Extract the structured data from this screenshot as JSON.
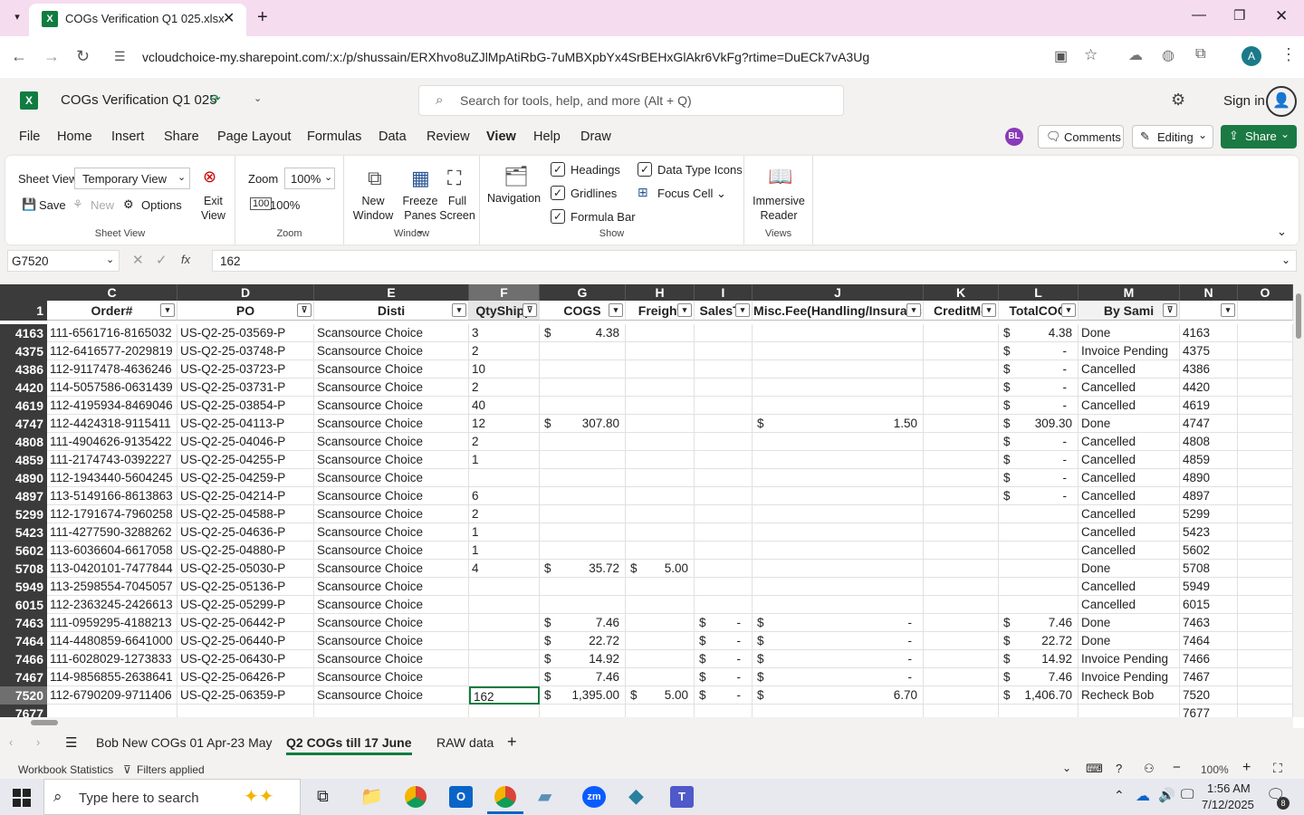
{
  "browser": {
    "tab_title": "COGs Verification Q1 025.xlsx",
    "url": "vcloudchoice-my.sharepoint.com/:x:/p/shussain/ERXhvo8uZJlMpAtiRbG-7uMBXpbYx4SrBEHxGlAkr6VkFg?rtime=DuECk7vA3Ug",
    "profile_initial": "A"
  },
  "app": {
    "file_title": "COGs Verification Q1 025",
    "search_placeholder": "Search for tools, help, and more (Alt + Q)",
    "sign_in": "Sign in",
    "user_initials": "BL",
    "comments": "Comments",
    "editing": "Editing",
    "share": "Share"
  },
  "menu": [
    "File",
    "Home",
    "Insert",
    "Share",
    "Page Layout",
    "Formulas",
    "Data",
    "Review",
    "View",
    "Help",
    "Draw"
  ],
  "ribbon": {
    "sheet_view_label": "Sheet View",
    "sheet_view_value": "Temporary View",
    "save": "Save",
    "new": "New",
    "options": "Options",
    "exit_view_1": "Exit",
    "exit_view_2": "View",
    "group_sheet_view": "Sheet View",
    "zoom_label": "Zoom",
    "zoom_value": "100%",
    "zoom_100": "100%",
    "group_zoom": "Zoom",
    "new_window_1": "New",
    "new_window_2": "Window",
    "freeze_1": "Freeze",
    "freeze_2": "Panes",
    "full_1": "Full",
    "full_2": "Screen",
    "group_window": "Window",
    "navigation": "Navigation",
    "headings": "Headings",
    "gridlines": "Gridlines",
    "formula_bar": "Formula Bar",
    "data_type_icons": "Data Type Icons",
    "focus_cell": "Focus Cell",
    "group_show": "Show",
    "immersive_1": "Immersive",
    "immersive_2": "Reader",
    "group_views": "Views"
  },
  "formula_bar": {
    "name_box": "G7520",
    "fx": "fx",
    "content": "162"
  },
  "columns": [
    {
      "letter": "C",
      "header": "Order#"
    },
    {
      "letter": "D",
      "header": "PO"
    },
    {
      "letter": "E",
      "header": "Disti"
    },
    {
      "letter": "F",
      "header": "QtyShipp"
    },
    {
      "letter": "G",
      "header": "COGS"
    },
    {
      "letter": "H",
      "header": "Freight"
    },
    {
      "letter": "I",
      "header": "SalesTa"
    },
    {
      "letter": "J",
      "header": "Misc.Fee(Handling/Insuranc"
    },
    {
      "letter": "K",
      "header": "CreditMe"
    },
    {
      "letter": "L",
      "header": "TotalCOG"
    },
    {
      "letter": "M",
      "header": "By Sami"
    },
    {
      "letter": "N",
      "header": ""
    },
    {
      "letter": "O",
      "header": ""
    }
  ],
  "header_row_num": "1",
  "rows": [
    {
      "n": "4163",
      "c": "111-6561716-8165032",
      "d": "US-Q2-25-03569-P",
      "e": "Scansource Choice",
      "f": "3",
      "g": "4.38",
      "h": "",
      "i": "",
      "j": "",
      "l": "4.38",
      "m": "Done"
    },
    {
      "n": "4375",
      "c": "112-6416577-2029819",
      "d": "US-Q2-25-03748-P",
      "e": "Scansource Choice",
      "f": "2",
      "g": "",
      "h": "",
      "i": "",
      "j": "",
      "l": "-",
      "m": "Invoice Pending"
    },
    {
      "n": "4386",
      "c": "112-9117478-4636246",
      "d": "US-Q2-25-03723-P",
      "e": "Scansource Choice",
      "f": "10",
      "g": "",
      "h": "",
      "i": "",
      "j": "",
      "l": "-",
      "m": "Cancelled"
    },
    {
      "n": "4420",
      "c": "114-5057586-0631439",
      "d": "US-Q2-25-03731-P",
      "e": "Scansource Choice",
      "f": "2",
      "g": "",
      "h": "",
      "i": "",
      "j": "",
      "l": "-",
      "m": "Cancelled"
    },
    {
      "n": "4619",
      "c": "112-4195934-8469046",
      "d": "US-Q2-25-03854-P",
      "e": "Scansource Choice",
      "f": "40",
      "g": "",
      "h": "",
      "i": "",
      "j": "",
      "l": "-",
      "m": "Cancelled"
    },
    {
      "n": "4747",
      "c": "112-4424318-9115411",
      "d": "US-Q2-25-04113-P",
      "e": "Scansource Choice",
      "f": "12",
      "g": "307.80",
      "h": "",
      "i": "",
      "j": "1.50",
      "l": "309.30",
      "m": "Done"
    },
    {
      "n": "4808",
      "c": "111-4904626-9135422",
      "d": "US-Q2-25-04046-P",
      "e": "Scansource Choice",
      "f": "2",
      "g": "",
      "h": "",
      "i": "",
      "j": "",
      "l": "-",
      "m": "Cancelled"
    },
    {
      "n": "4859",
      "c": "111-2174743-0392227",
      "d": "US-Q2-25-04255-P",
      "e": "Scansource Choice",
      "f": "1",
      "g": "",
      "h": "",
      "i": "",
      "j": "",
      "l": "-",
      "m": "Cancelled"
    },
    {
      "n": "4890",
      "c": "112-1943440-5604245",
      "d": "US-Q2-25-04259-P",
      "e": "Scansource Choice",
      "f": "",
      "g": "",
      "h": "",
      "i": "",
      "j": "",
      "l": "-",
      "m": "Cancelled"
    },
    {
      "n": "4897",
      "c": "113-5149166-8613863",
      "d": "US-Q2-25-04214-P",
      "e": "Scansource Choice",
      "f": "6",
      "g": "",
      "h": "",
      "i": "",
      "j": "",
      "l": "-",
      "m": "Cancelled"
    },
    {
      "n": "5299",
      "c": "112-1791674-7960258",
      "d": "US-Q2-25-04588-P",
      "e": "Scansource Choice",
      "f": "2",
      "g": "",
      "h": "",
      "i": "",
      "j": "",
      "l": "",
      "m": "Cancelled"
    },
    {
      "n": "5423",
      "c": "111-4277590-3288262",
      "d": "US-Q2-25-04636-P",
      "e": "Scansource Choice",
      "f": "1",
      "g": "",
      "h": "",
      "i": "",
      "j": "",
      "l": "",
      "m": "Cancelled"
    },
    {
      "n": "5602",
      "c": "113-6036604-6617058",
      "d": "US-Q2-25-04880-P",
      "e": "Scansource Choice",
      "f": "1",
      "g": "",
      "h": "",
      "i": "",
      "j": "",
      "l": "",
      "m": "Cancelled"
    },
    {
      "n": "5708",
      "c": "113-0420101-7477844",
      "d": "US-Q2-25-05030-P",
      "e": "Scansource Choice",
      "f": "4",
      "g": "35.72",
      "h": "5.00",
      "i": "",
      "j": "",
      "l": "",
      "m": "Done"
    },
    {
      "n": "5949",
      "c": "113-2598554-7045057",
      "d": "US-Q2-25-05136-P",
      "e": "Scansource Choice",
      "f": "",
      "g": "",
      "h": "",
      "i": "",
      "j": "",
      "l": "",
      "m": "Cancelled"
    },
    {
      "n": "6015",
      "c": "112-2363245-2426613",
      "d": "US-Q2-25-05299-P",
      "e": "Scansource Choice",
      "f": "",
      "g": "",
      "h": "",
      "i": "",
      "j": "",
      "l": "",
      "m": "Cancelled"
    },
    {
      "n": "7463",
      "c": "111-0959295-4188213",
      "d": "US-Q2-25-06442-P",
      "e": "Scansource Choice",
      "f": "",
      "g": "7.46",
      "h": "",
      "i": "-",
      "j": "-",
      "l": "7.46",
      "m": "Done"
    },
    {
      "n": "7464",
      "c": "114-4480859-6641000",
      "d": "US-Q2-25-06440-P",
      "e": "Scansource Choice",
      "f": "",
      "g": "22.72",
      "h": "",
      "i": "-",
      "j": "-",
      "l": "22.72",
      "m": "Done"
    },
    {
      "n": "7466",
      "c": "111-6028029-1273833",
      "d": "US-Q2-25-06430-P",
      "e": "Scansource Choice",
      "f": "",
      "g": "14.92",
      "h": "",
      "i": "-",
      "j": "-",
      "l": "14.92",
      "m": "Invoice Pending"
    },
    {
      "n": "7467",
      "c": "114-9856855-2638641",
      "d": "US-Q2-25-06426-P",
      "e": "Scansource Choice",
      "f": "",
      "g": "7.46",
      "h": "",
      "i": "-",
      "j": "-",
      "l": "7.46",
      "m": "Invoice Pending"
    },
    {
      "n": "7520",
      "c": "112-6790209-9711406",
      "d": "US-Q2-25-06359-P",
      "e": "Scansource Choice",
      "f": "162",
      "g": "1,395.00",
      "h": "5.00",
      "i": "-",
      "j": "6.70",
      "l": "1,406.70",
      "m": "Recheck Bob"
    },
    {
      "n": "7677",
      "c": "",
      "d": "",
      "e": "",
      "f": "",
      "g": "",
      "h": "",
      "i": "",
      "j": "",
      "l": "",
      "m": ""
    }
  ],
  "currency_symbol": "$",
  "sheet_tabs": [
    "Bob New COGs 01 Apr-23 May",
    "Q2 COGs till 17 June",
    "RAW data"
  ],
  "active_sheet_index": 1,
  "status": {
    "workbook_stats": "Workbook Statistics",
    "filters": "Filters applied",
    "zoom": "100%"
  },
  "taskbar": {
    "search_placeholder": "Type here to search",
    "time": "1:56 AM",
    "date": "7/12/2025",
    "notif_count": "8"
  },
  "colors": {
    "excel_green": "#107c41",
    "accent": "#1b7a43",
    "tab_bg": "#f6dcef"
  }
}
